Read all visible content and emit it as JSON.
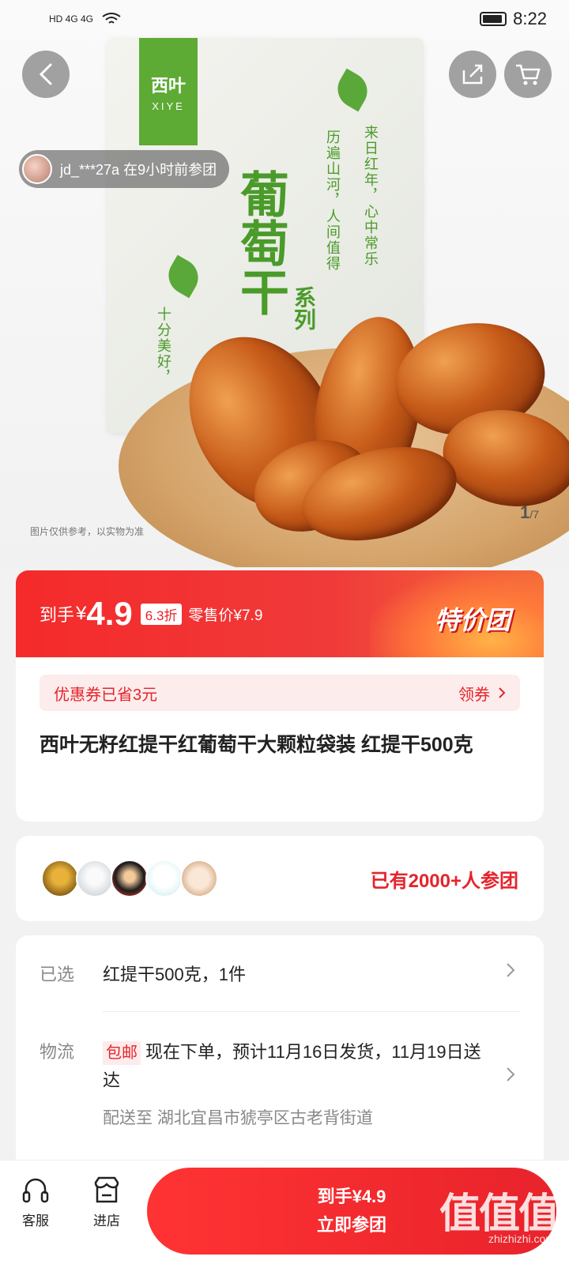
{
  "status_bar": {
    "left_indicators": "HD 4G 4G",
    "time": "8:22"
  },
  "hero": {
    "bag_brand_cn": "西叶",
    "bag_brand_en": "XIYE",
    "bag_title": "葡萄干",
    "bag_series": "系列",
    "bag_slogan_1": "来日红年，心中常乐",
    "bag_slogan_2": "历遍山河，人间值得",
    "bag_slogan_3": "十分美好，",
    "caption": "图片仅供参考，以实物为准",
    "counter_current": "1",
    "counter_total": "/7"
  },
  "join_banner": {
    "text": "jd_***27a  在9小时前参团"
  },
  "price": {
    "label": "到手",
    "currency": "¥",
    "value": "4.9",
    "discount": "6.3折",
    "retail": "零售价¥7.9",
    "tag": "特价团"
  },
  "coupon": {
    "saved": "优惠券已省3元",
    "action": "领券"
  },
  "product": {
    "title": "西叶无籽红提干红葡萄干大颗粒袋装 红提干500克"
  },
  "group": {
    "joined_text": "已有2000+人参团"
  },
  "selected": {
    "label": "已选",
    "value": "红提干500克，1件"
  },
  "logistics": {
    "label": "物流",
    "badge": "包邮",
    "text": "现在下单，预计11月16日发货，11月19日送达",
    "ship_to": "配送至  湖北宜昌市猇亭区古老背街道"
  },
  "bottom": {
    "service_label": "客服",
    "store_label": "进店",
    "cta_price": "到手¥4.9",
    "cta_action": "立即参团",
    "watermark": "值值值",
    "watermark_sub": "zhizhizhi.com"
  },
  "colors": {
    "accent": "#e5242b",
    "green": "#5dab35"
  }
}
